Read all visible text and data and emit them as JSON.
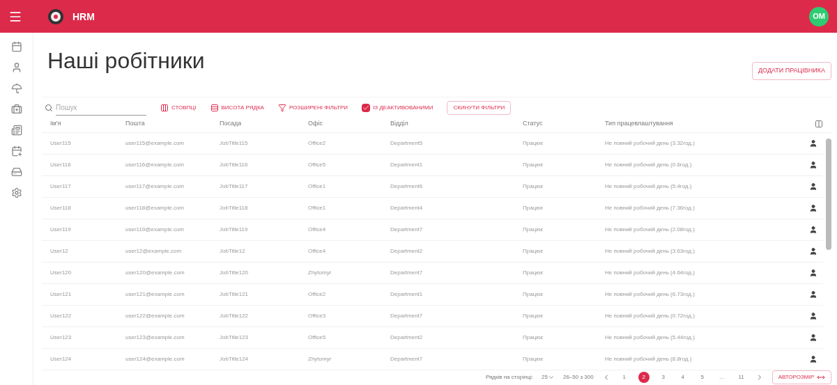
{
  "app_bar": {
    "title": "HRM",
    "avatar": "OM"
  },
  "page_title": "Наші робітники",
  "add_button": "ДОДАТИ ПРАЦІВНИКА",
  "toolbar": {
    "search": {
      "placeholder": "Пошук"
    },
    "buttons": [
      {
        "kind": "columns",
        "label": "СТОВПЦІ"
      },
      {
        "kind": "density",
        "label": "ВИСОТА РЯДКА"
      },
      {
        "kind": "filter",
        "label": "РОЗШИРЕНІ ФІЛЬТРИ"
      }
    ],
    "deactivated": {
      "label": "ІЗ ДЕАКТИВОВАНИМИ",
      "checked": true
    },
    "reset": "СКИНУТИ ФІЛЬТРИ"
  },
  "table": {
    "columns": [
      "Ім'я",
      "Пошта",
      "Посада",
      "Офіс",
      "Відділ",
      "Статус",
      "Тип працевлаштування"
    ],
    "rows": [
      [
        "User115",
        "user115@example.com",
        "JobTitle115",
        "Office2",
        "Department5",
        "Працює",
        "Не повний робочий день (3.32год.)"
      ],
      [
        "User116",
        "user116@example.com",
        "JobTitle116",
        "Office5",
        "Department1",
        "Працює",
        "Не повний робочий день (0.6год.)"
      ],
      [
        "User117",
        "user117@example.com",
        "JobTitle117",
        "Office1",
        "Department6",
        "Працює",
        "Не повний робочий день (5.4год.)"
      ],
      [
        "User118",
        "user118@example.com",
        "JobTitle118",
        "Office1",
        "Department4",
        "Працює",
        "Не повний робочий день (7.36год.)"
      ],
      [
        "User119",
        "user119@example.com",
        "JobTitle119",
        "Office4",
        "Department7",
        "Працює",
        "Не повний робочий день (2.08год.)"
      ],
      [
        "User12",
        "user12@example.com",
        "JobTitle12",
        "Office4",
        "Department2",
        "Працює",
        "Не повний робочий день (3.63год.)"
      ],
      [
        "User120",
        "user120@example.com",
        "JobTitle120",
        "Zhytomyr",
        "Department7",
        "Працює",
        "Не повний робочий день (4.64год.)"
      ],
      [
        "User121",
        "user121@example.com",
        "JobTitle121",
        "Office2",
        "Department1",
        "Працює",
        "Не повний робочий день (6.73год.)"
      ],
      [
        "User122",
        "user122@example.com",
        "JobTitle122",
        "Office3",
        "Department7",
        "Працює",
        "Не повний робочий день (0.72год.)"
      ],
      [
        "User123",
        "user123@example.com",
        "JobTitle123",
        "Office5",
        "Department2",
        "Працює",
        "Не повний робочий день (5.44год.)"
      ],
      [
        "User124",
        "user124@example.com",
        "JobTitle124",
        "Zhytomyr",
        "Department7",
        "Працює",
        "Не повний робочий день (8.8год.)"
      ]
    ]
  },
  "footer": {
    "rows_per_page_label": "Рядків на сторінці:",
    "rows_per_page": "25",
    "range": "26–50 з 300",
    "pages": [
      {
        "label": "1",
        "selected": false
      },
      {
        "label": "2",
        "selected": true
      },
      {
        "label": "3",
        "selected": false
      },
      {
        "label": "4",
        "selected": false
      },
      {
        "label": "5",
        "selected": false
      },
      {
        "label": "…",
        "selected": false
      },
      {
        "label": "11",
        "selected": false
      }
    ],
    "autosize": "АВТОРОЗМІР"
  }
}
